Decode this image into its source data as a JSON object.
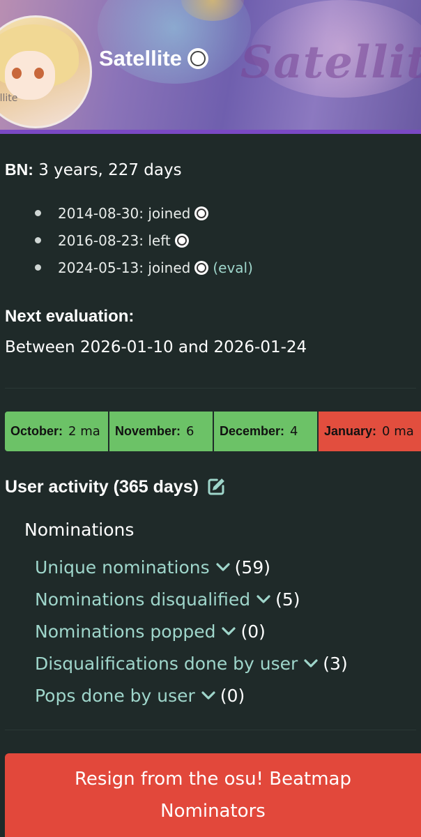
{
  "profile": {
    "username": "Satellite",
    "banner_text": "Satellite",
    "avatar_caption": "ellite"
  },
  "bn": {
    "label": "BN:",
    "duration": "3 years, 227 days",
    "history": [
      {
        "text": "2014-08-30: joined",
        "note": ""
      },
      {
        "text": "2016-08-23: left",
        "note": ""
      },
      {
        "text": "2024-05-13: joined",
        "note": "(eval)"
      }
    ]
  },
  "evaluation": {
    "title": "Next evaluation:",
    "value": "Between 2026-01-10 and 2026-01-24"
  },
  "months": [
    {
      "name": "October:",
      "value": "2 ma",
      "status": "good"
    },
    {
      "name": "November:",
      "value": "6",
      "status": "good"
    },
    {
      "name": "December:",
      "value": "4",
      "status": "good"
    },
    {
      "name": "January:",
      "value": "0 ma",
      "status": "bad"
    }
  ],
  "activity": {
    "title": "User activity (365 days)",
    "section": "Nominations",
    "stats": [
      {
        "label": "Unique nominations",
        "count": "(59)"
      },
      {
        "label": "Nominations disqualified",
        "count": "(5)"
      },
      {
        "label": "Nominations popped",
        "count": "(0)"
      },
      {
        "label": "Disqualifications done by user",
        "count": "(3)"
      },
      {
        "label": "Pops done by user",
        "count": "(0)"
      }
    ]
  },
  "resign_button": "Resign from the osu! Beatmap Nominators",
  "colors": {
    "background": "#1f2a29",
    "accent_purple": "#7a49c4",
    "link_teal": "#9fd6cb",
    "month_good": "#6cc267",
    "month_bad": "#e24e3e",
    "resign_red": "#e2483b"
  },
  "icons": {
    "mode": "osu-standard-icon",
    "edit": "edit-icon",
    "expand": "chevron-down-icon"
  }
}
